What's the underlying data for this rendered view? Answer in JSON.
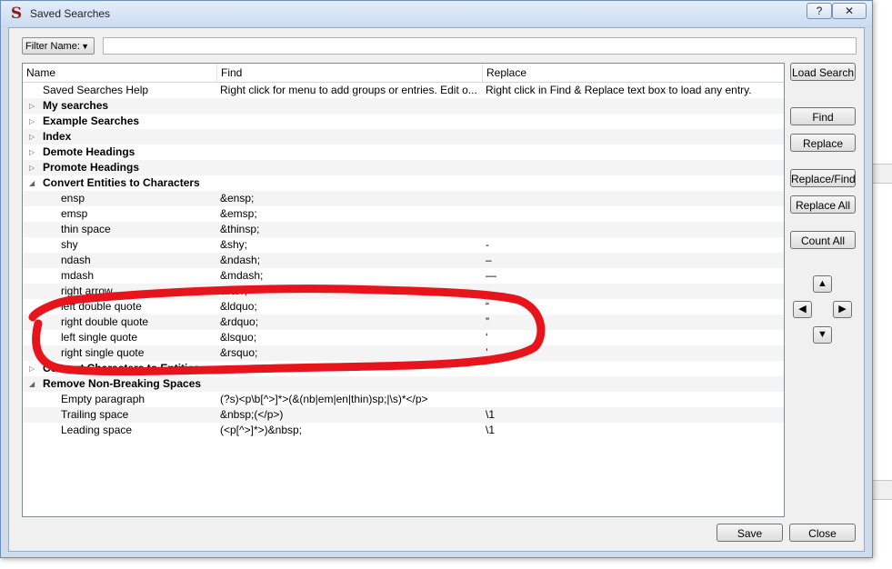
{
  "window": {
    "title": "Saved Searches",
    "help_label": "?",
    "close_label": "✕",
    "app_icon": "S"
  },
  "filter": {
    "label": "Filter Name:",
    "value": ""
  },
  "columns": [
    "Name",
    "Find",
    "Replace"
  ],
  "rows": [
    {
      "name": "Saved Searches Help",
      "find": "Right click for menu to add groups or entries.  Edit o...",
      "replace": "Right click in Find & Replace text box to load any entry.",
      "level": 1,
      "group": false,
      "expander": ""
    },
    {
      "name": "My searches",
      "find": "",
      "replace": "",
      "level": 1,
      "group": true,
      "expander": "▷"
    },
    {
      "name": "Example Searches",
      "find": "",
      "replace": "",
      "level": 1,
      "group": true,
      "expander": "▷"
    },
    {
      "name": "Index",
      "find": "",
      "replace": "",
      "level": 1,
      "group": true,
      "expander": "▷"
    },
    {
      "name": "Demote Headings",
      "find": "",
      "replace": "",
      "level": 1,
      "group": true,
      "expander": "▷"
    },
    {
      "name": "Promote Headings",
      "find": "",
      "replace": "",
      "level": 1,
      "group": true,
      "expander": "▷"
    },
    {
      "name": "Convert Entities to Characters",
      "find": "",
      "replace": "",
      "level": 1,
      "group": true,
      "expander": "◢"
    },
    {
      "name": "ensp",
      "find": "&ensp;",
      "replace": "",
      "level": 2,
      "group": false,
      "expander": ""
    },
    {
      "name": "emsp",
      "find": "&emsp;",
      "replace": "",
      "level": 2,
      "group": false,
      "expander": ""
    },
    {
      "name": "thin space",
      "find": "&thinsp;",
      "replace": "",
      "level": 2,
      "group": false,
      "expander": ""
    },
    {
      "name": "shy",
      "find": "&shy;",
      "replace": "-",
      "level": 2,
      "group": false,
      "expander": ""
    },
    {
      "name": "ndash",
      "find": "&ndash;",
      "replace": "–",
      "level": 2,
      "group": false,
      "expander": ""
    },
    {
      "name": "mdash",
      "find": "&mdash;",
      "replace": "—",
      "level": 2,
      "group": false,
      "expander": ""
    },
    {
      "name": "right arrow",
      "find": "&rarr;",
      "replace": "→",
      "level": 2,
      "group": false,
      "expander": ""
    },
    {
      "name": "left double quote",
      "find": "&ldquo;",
      "replace": "“",
      "level": 2,
      "group": false,
      "expander": ""
    },
    {
      "name": "right double quote",
      "find": "&rdquo;",
      "replace": "”",
      "level": 2,
      "group": false,
      "expander": ""
    },
    {
      "name": "left single quote",
      "find": "&lsquo;",
      "replace": "‘",
      "level": 2,
      "group": false,
      "expander": ""
    },
    {
      "name": "right single quote",
      "find": "&rsquo;",
      "replace": "’",
      "level": 2,
      "group": false,
      "expander": ""
    },
    {
      "name": "Convert Characters to Entities",
      "find": "",
      "replace": "",
      "level": 1,
      "group": true,
      "expander": "▷"
    },
    {
      "name": "Remove Non-Breaking Spaces",
      "find": "",
      "replace": "",
      "level": 1,
      "group": true,
      "expander": "◢"
    },
    {
      "name": "Empty paragraph",
      "find": "(?s)<p\\b[^>]*>(&(nb|em|en|thin)sp;|\\s)*</p>",
      "replace": "",
      "level": 2,
      "group": false,
      "expander": ""
    },
    {
      "name": "Trailing space",
      "find": "&nbsp;(</p>)",
      "replace": "\\1",
      "level": 2,
      "group": false,
      "expander": ""
    },
    {
      "name": "Leading space",
      "find": "(<p[^>]*>)&nbsp;",
      "replace": "\\1",
      "level": 2,
      "group": false,
      "expander": ""
    }
  ],
  "buttons": {
    "load_search": "Load Search",
    "find": "Find",
    "replace": "Replace",
    "replace_find": "Replace/Find",
    "replace_all": "Replace All",
    "count_all": "Count All",
    "save": "Save",
    "close": "Close"
  },
  "arrows": {
    "up": "▲",
    "left": "◀",
    "right": "▶",
    "down": "▼"
  },
  "colors": {
    "annotation": "#e8141c",
    "title_bar": "#cbdbef",
    "app_icon": "#8c1d1d"
  }
}
